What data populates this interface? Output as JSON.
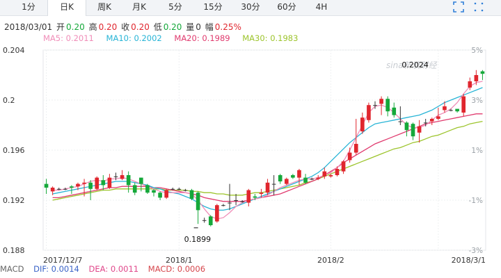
{
  "tabs": [
    "1分",
    "日K",
    "周K",
    "月K",
    "5分",
    "15分",
    "30分",
    "60分",
    "4H"
  ],
  "active_tab": 1,
  "info": {
    "date": "2018/03/01",
    "open_label": "开",
    "open_value": "0.20",
    "high_label": "高",
    "high_value": "0.20",
    "close_label": "收",
    "close_value": "0.20",
    "low_label": "低",
    "low_value": "0.20",
    "volume_label": "量",
    "volume_value": "0",
    "change_label": "幅",
    "change_value": "0.25%"
  },
  "ma_legend": [
    {
      "text": "MA5: 0.2011",
      "color": "#f08db8"
    },
    {
      "text": "MA10: 0.2002",
      "color": "#27b4d6"
    },
    {
      "text": "MA20: 0.1989",
      "color": "#e03a6e"
    },
    {
      "text": "MA30: 0.1983",
      "color": "#9cc42b"
    }
  ],
  "macd": [
    {
      "text": "MACD",
      "color": "#666666"
    },
    {
      "text": "DIF: 0.0014",
      "color": "#3a63c7"
    },
    {
      "text": "DEA: 0.0011",
      "color": "#e0468a"
    },
    {
      "text": "MACD: 0.0006",
      "color": "#d6454b"
    }
  ],
  "watermark": "sina新浪财经",
  "chart_data": {
    "type": "candlestick",
    "y_ticks": [
      "0.204",
      "0.2",
      "0.196",
      "0.192",
      "0.188"
    ],
    "y_tick_values": [
      0.204,
      0.2,
      0.196,
      0.192,
      0.188
    ],
    "pct_ticks": [
      "5%",
      "3%",
      "1%",
      "-1%",
      "-3%"
    ],
    "ylim": [
      0.188,
      0.204
    ],
    "x_labels": [
      "2017/12/7",
      "2018/1",
      "2018/2",
      "2018/3/1"
    ],
    "x_label_index": [
      0,
      21,
      45,
      62
    ],
    "annotations": [
      {
        "text": "0.1899",
        "index": 24,
        "value": 0.1899
      },
      {
        "text": "0.2024",
        "index": 62,
        "value": 0.2024
      }
    ],
    "colors": {
      "up": "#e0262e",
      "down": "#15a83a",
      "flat": "#333333"
    },
    "candles": [
      [
        0.1933,
        0.193,
        0.1937,
        0.1925
      ],
      [
        0.1927,
        0.193,
        0.1931,
        0.1924
      ],
      [
        0.1929,
        0.1929,
        0.193,
        0.1928
      ],
      [
        0.1929,
        0.1929,
        0.193,
        0.1928
      ],
      [
        0.1931,
        0.193,
        0.1932,
        0.1925
      ],
      [
        0.1931,
        0.1933,
        0.1934,
        0.1928
      ],
      [
        0.1933,
        0.1934,
        0.1937,
        0.1923
      ],
      [
        0.1934,
        0.1929,
        0.1936,
        0.192
      ],
      [
        0.1929,
        0.1938,
        0.1939,
        0.1928
      ],
      [
        0.1936,
        0.1932,
        0.194,
        0.1928
      ],
      [
        0.193,
        0.1938,
        0.1941,
        0.1929
      ],
      [
        0.1939,
        0.1939,
        0.1942,
        0.1936
      ],
      [
        0.1937,
        0.194,
        0.1944,
        0.1936
      ],
      [
        0.194,
        0.1932,
        0.1943,
        0.1926
      ],
      [
        0.1932,
        0.1926,
        0.1934,
        0.1924
      ],
      [
        0.1938,
        0.1933,
        0.1938,
        0.1927
      ],
      [
        0.1932,
        0.1926,
        0.1933,
        0.1925
      ],
      [
        0.1928,
        0.1926,
        0.1929,
        0.1923
      ],
      [
        0.1926,
        0.1922,
        0.1927,
        0.192
      ],
      [
        0.1922,
        0.1928,
        0.1929,
        0.1921
      ],
      [
        0.1929,
        0.1929,
        0.193,
        0.1928
      ],
      [
        0.1929,
        0.1929,
        0.193,
        0.1928
      ],
      [
        0.1928,
        0.1928,
        0.1929,
        0.1927
      ],
      [
        0.1928,
        0.1921,
        0.1929,
        0.192
      ],
      [
        0.1926,
        0.1912,
        0.1927,
        0.1901
      ],
      [
        0.1904,
        0.1904,
        0.1906,
        0.1902
      ],
      [
        0.1907,
        0.19,
        0.1908,
        0.1899
      ],
      [
        0.1903,
        0.1916,
        0.1917,
        0.1902
      ],
      [
        0.1916,
        0.1916,
        0.1917,
        0.1915
      ],
      [
        0.1918,
        0.1918,
        0.1933,
        0.1912
      ],
      [
        0.192,
        0.192,
        0.1925,
        0.1916
      ],
      [
        0.1919,
        0.1919,
        0.192,
        0.1918
      ],
      [
        0.1918,
        0.1928,
        0.1929,
        0.1915
      ],
      [
        0.1923,
        0.1922,
        0.1925,
        0.192
      ],
      [
        0.1925,
        0.1926,
        0.1929,
        0.1922
      ],
      [
        0.1926,
        0.1934,
        0.1937,
        0.1924
      ],
      [
        0.1933,
        0.1933,
        0.194,
        0.1924
      ],
      [
        0.194,
        0.1935,
        0.1941,
        0.1933
      ],
      [
        0.1933,
        0.1937,
        0.1938,
        0.1932
      ],
      [
        0.194,
        0.1938,
        0.1941,
        0.1937
      ],
      [
        0.1938,
        0.1944,
        0.1945,
        0.1932
      ],
      [
        0.1938,
        0.1934,
        0.1941,
        0.1933
      ],
      [
        0.1937,
        0.1937,
        0.1938,
        0.1936
      ],
      [
        0.1937,
        0.1938,
        0.194,
        0.1936
      ],
      [
        0.1939,
        0.1943,
        0.1946,
        0.1937
      ],
      [
        0.1939,
        0.194,
        0.1941,
        0.1938
      ],
      [
        0.194,
        0.1945,
        0.1947,
        0.1939
      ],
      [
        0.1943,
        0.1951,
        0.1952,
        0.1941
      ],
      [
        0.1952,
        0.1958,
        0.1962,
        0.195
      ],
      [
        0.1958,
        0.1965,
        0.1985,
        0.1956
      ],
      [
        0.1975,
        0.1986,
        0.199,
        0.1973
      ],
      [
        0.1984,
        0.1996,
        0.1998,
        0.1982
      ],
      [
        0.1996,
        0.1996,
        0.1999,
        0.1993
      ],
      [
        0.1997,
        0.2001,
        0.2003,
        0.1988
      ],
      [
        0.2001,
        0.1991,
        0.2003,
        0.1987
      ],
      [
        0.1994,
        0.1988,
        0.1998,
        0.1986
      ],
      [
        0.1983,
        0.1983,
        0.1995,
        0.198
      ],
      [
        0.1982,
        0.1976,
        0.1983,
        0.1971
      ],
      [
        0.1981,
        0.1971,
        0.1982,
        0.1968
      ],
      [
        0.1974,
        0.1979,
        0.1984,
        0.1966
      ],
      [
        0.1982,
        0.1982,
        0.1985,
        0.1979
      ],
      [
        0.1983,
        0.1985,
        0.1986,
        0.198
      ],
      [
        0.1985,
        0.1987,
        0.1994,
        0.1984
      ],
      [
        0.1992,
        0.1995,
        0.1999,
        0.199
      ],
      [
        0.1992,
        0.1992,
        0.1993,
        0.1991
      ],
      [
        0.1993,
        0.1991,
        0.1992,
        0.199
      ],
      [
        0.199,
        0.2003,
        0.2005,
        0.1987
      ],
      [
        0.201,
        0.2015,
        0.2018,
        0.2008
      ],
      [
        0.2015,
        0.202,
        0.2024,
        0.2012
      ],
      [
        0.2023,
        0.2021,
        0.2024,
        0.2016
      ]
    ],
    "ma5": [
      0.1928,
      0.1928,
      0.1929,
      0.193,
      0.1931,
      0.1933,
      0.1935,
      0.1936,
      0.1935,
      0.1937,
      0.1937,
      0.1938,
      0.1937,
      0.1935,
      0.1933,
      0.1931,
      0.1929,
      0.1927,
      0.1926,
      0.1926,
      0.1926,
      0.1926,
      0.1925,
      0.192,
      0.1913,
      0.1907,
      0.1905,
      0.1906,
      0.191,
      0.1915,
      0.1918,
      0.192,
      0.1921,
      0.1922,
      0.1924,
      0.1927,
      0.193,
      0.1932,
      0.1934,
      0.1936,
      0.1937,
      0.1937,
      0.1938,
      0.194,
      0.1942,
      0.1946,
      0.1951,
      0.196,
      0.197,
      0.198,
      0.199,
      0.1995,
      0.1996,
      0.1994,
      0.199,
      0.1985,
      0.198,
      0.1978,
      0.1978,
      0.198,
      0.1984,
      0.1988,
      0.199,
      0.1993,
      0.1998,
      0.2005,
      0.2011,
      0.2014,
      0.2015
    ],
    "ma10": [
      0.1925,
      0.1926,
      0.1927,
      0.1928,
      0.1929,
      0.193,
      0.1931,
      0.1932,
      0.1933,
      0.1934,
      0.1935,
      0.1935,
      0.1935,
      0.1934,
      0.1933,
      0.1932,
      0.193,
      0.1929,
      0.1927,
      0.1926,
      0.1925,
      0.1923,
      0.1921,
      0.1918,
      0.1915,
      0.1913,
      0.1912,
      0.1912,
      0.1913,
      0.1915,
      0.1917,
      0.1919,
      0.1921,
      0.1923,
      0.1925,
      0.1927,
      0.1929,
      0.1931,
      0.1933,
      0.1935,
      0.1937,
      0.1939,
      0.1942,
      0.1946,
      0.1951,
      0.1956,
      0.1961,
      0.1966,
      0.197,
      0.1974,
      0.1978,
      0.1981,
      0.1982,
      0.1983,
      0.1984,
      0.1985,
      0.1986,
      0.1987,
      0.1988,
      0.199,
      0.1992,
      0.1995,
      0.1998,
      0.2,
      0.2002,
      0.2004,
      0.2006,
      0.2008,
      0.201
    ],
    "ma20": [
      0.1922,
      0.1922,
      0.1923,
      0.1924,
      0.1925,
      0.1926,
      0.1927,
      0.1928,
      0.1929,
      0.193,
      0.193,
      0.1931,
      0.1931,
      0.1931,
      0.1931,
      0.1931,
      0.193,
      0.193,
      0.1929,
      0.1928,
      0.1927,
      0.1926,
      0.1925,
      0.1924,
      0.1922,
      0.1921,
      0.192,
      0.1919,
      0.1919,
      0.1919,
      0.1919,
      0.192,
      0.1921,
      0.1922,
      0.1923,
      0.1924,
      0.1925,
      0.1927,
      0.1929,
      0.1931,
      0.1933,
      0.1935,
      0.1937,
      0.194,
      0.1943,
      0.1946,
      0.195,
      0.1953,
      0.1956,
      0.1959,
      0.1962,
      0.1965,
      0.1967,
      0.1969,
      0.1971,
      0.1973,
      0.1975,
      0.1977,
      0.1979,
      0.1981,
      0.1982,
      0.1983,
      0.1984,
      0.1985,
      0.1986,
      0.1987,
      0.1988,
      0.1989,
      0.1989
    ],
    "ma30": [
      0.192,
      0.1921,
      0.1922,
      0.1923,
      0.1924,
      0.1925,
      0.1926,
      0.1927,
      0.1928,
      0.1928,
      0.1929,
      0.1929,
      0.1929,
      0.1929,
      0.1929,
      0.1929,
      0.1929,
      0.1929,
      0.1928,
      0.1928,
      0.1928,
      0.1928,
      0.1927,
      0.1927,
      0.1926,
      0.1926,
      0.1925,
      0.1925,
      0.1924,
      0.1924,
      0.1924,
      0.1925,
      0.1926,
      0.1926,
      0.1927,
      0.1928,
      0.1929,
      0.193,
      0.1931,
      0.1932,
      0.1934,
      0.1935,
      0.1937,
      0.1939,
      0.1941,
      0.1943,
      0.1945,
      0.1947,
      0.1949,
      0.1951,
      0.1953,
      0.1955,
      0.1957,
      0.1959,
      0.1961,
      0.1962,
      0.1964,
      0.1966,
      0.1967,
      0.1969,
      0.1971,
      0.1972,
      0.1974,
      0.1976,
      0.1978,
      0.1979,
      0.1981,
      0.1982,
      0.1983
    ]
  }
}
